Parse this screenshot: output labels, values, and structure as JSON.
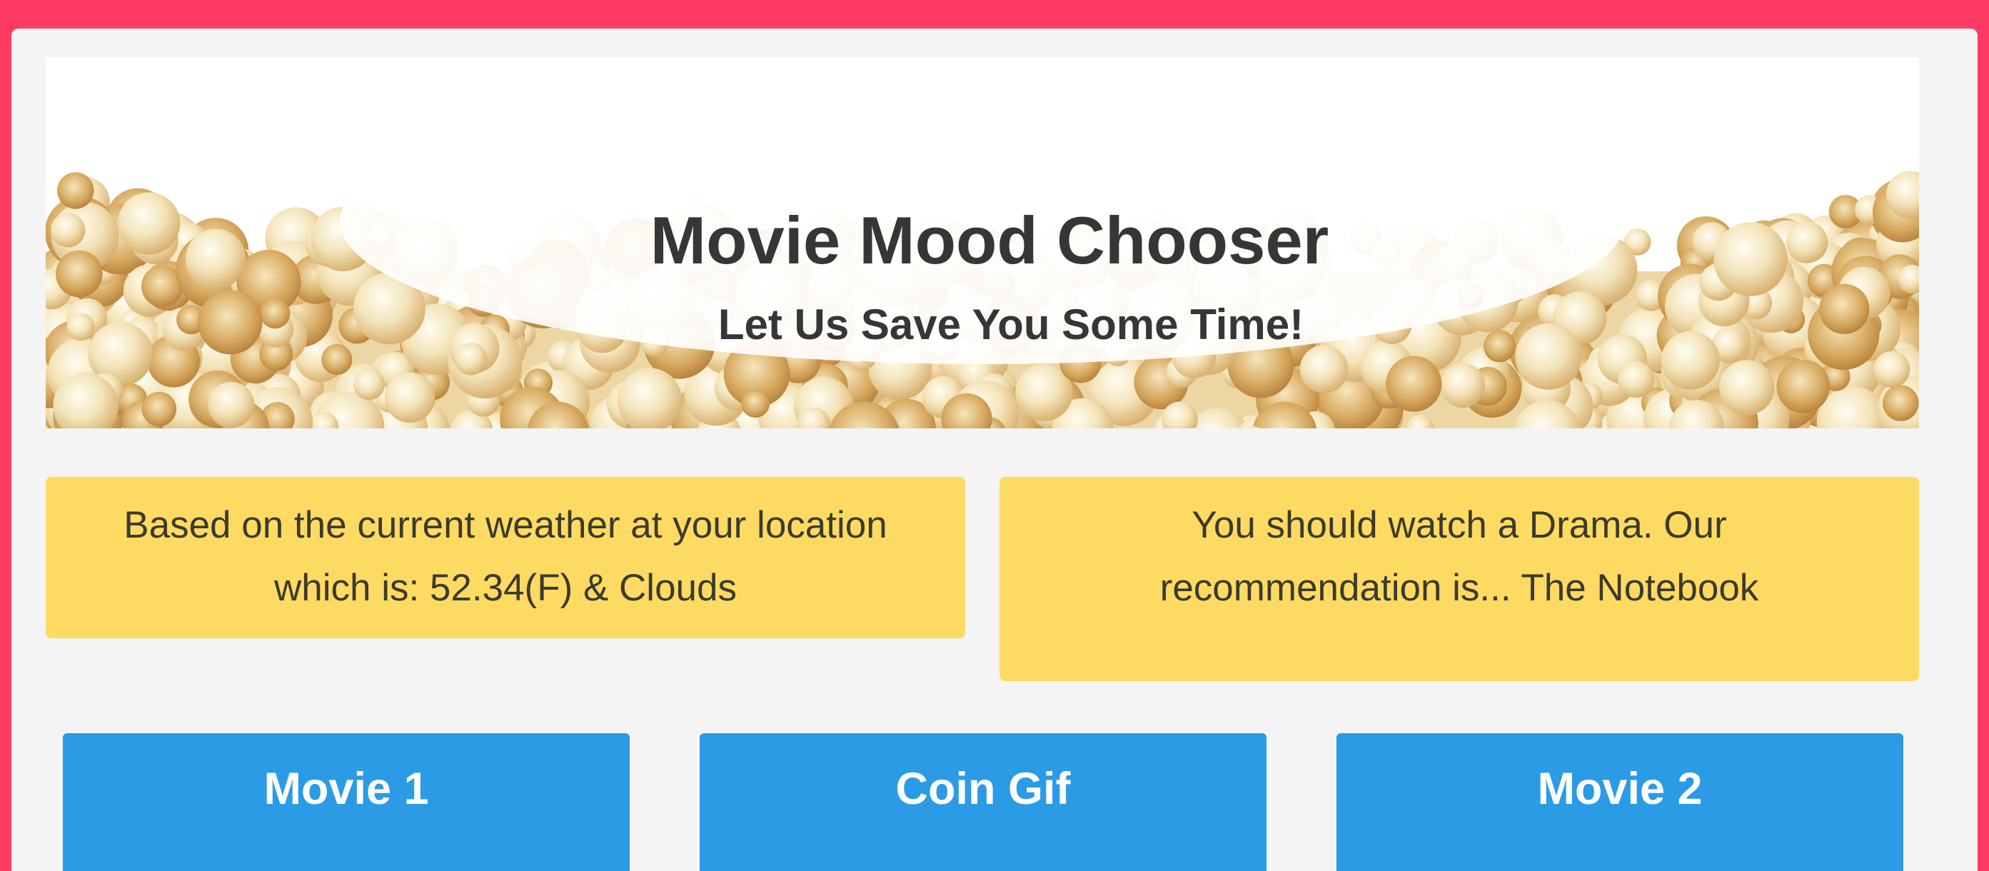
{
  "header": {
    "title": "Movie Mood Chooser",
    "subtitle": "Let Us Save You Some Time!"
  },
  "weather_notice": {
    "line1": "Based on the current weather at your location",
    "line2": "which is: 52.34(F) & Clouds"
  },
  "recommendation_notice": {
    "line1": "You should watch a Drama. Our",
    "line2": "recommendation is... The Notebook"
  },
  "buttons": {
    "movie1": "Movie 1",
    "coin_gif": "Coin Gif",
    "movie2": "Movie 2"
  },
  "colors": {
    "page_border": "#ff3b63",
    "card_background": "#f4f4f4",
    "notice_background": "#fddb62",
    "button_background": "#2b9be6"
  },
  "hero_image": "popcorn-banner"
}
